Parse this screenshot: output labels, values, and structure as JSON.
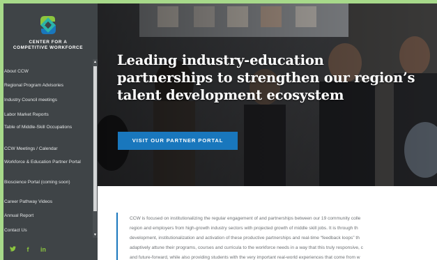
{
  "brand": {
    "line1": "CENTER FOR A",
    "line2": "COMPETITIVE WORKFORCE",
    "logo_icon": "ccw-logo-icon",
    "colors": {
      "green": "#8cc63f",
      "blue": "#1977bd",
      "teal": "#2bb3a9"
    }
  },
  "sidebar": {
    "items": [
      {
        "label": "About CCW"
      },
      {
        "label": "Regional Program Advisories"
      },
      {
        "label": "Industry Council meetings"
      },
      {
        "label": "Labor Market Reports"
      },
      {
        "label": "Table of Middle-Skill Occupations"
      },
      {
        "label": "CCW Meetings / Calendar"
      },
      {
        "label": "Workforce & Education Partner Portal"
      },
      {
        "label": "Bioscience Portal (coming soon)"
      },
      {
        "label": "Career Pathway Videos"
      },
      {
        "label": "Annual Report"
      },
      {
        "label": "Contact Us"
      }
    ],
    "social": [
      {
        "icon": "twitter-icon",
        "glyph": "🐦"
      },
      {
        "icon": "facebook-icon",
        "glyph": "f"
      },
      {
        "icon": "linkedin-icon",
        "glyph": "in"
      }
    ]
  },
  "hero": {
    "title": "Leading industry-education partnerships to strengthen our region’s talent development ecosystem",
    "cta_label": "VISIT OUR PARTNER PORTAL"
  },
  "intro": {
    "lines": [
      "CCW is focused on institutionalizing the regular engagement of and partnerships between our 19 community colle",
      "region and employers from high-growth industry sectors with projected growth of middle skill jobs. It is through th",
      "development, institutionalization and activation of these productive partnerships and real-time “feedback loops” th",
      "adaptively attune their programs, courses and curricula to the workforce needs in a way that this truly responsive, c",
      "and future-forward, while also providing students with the very important real-world experiences that come from w"
    ]
  }
}
